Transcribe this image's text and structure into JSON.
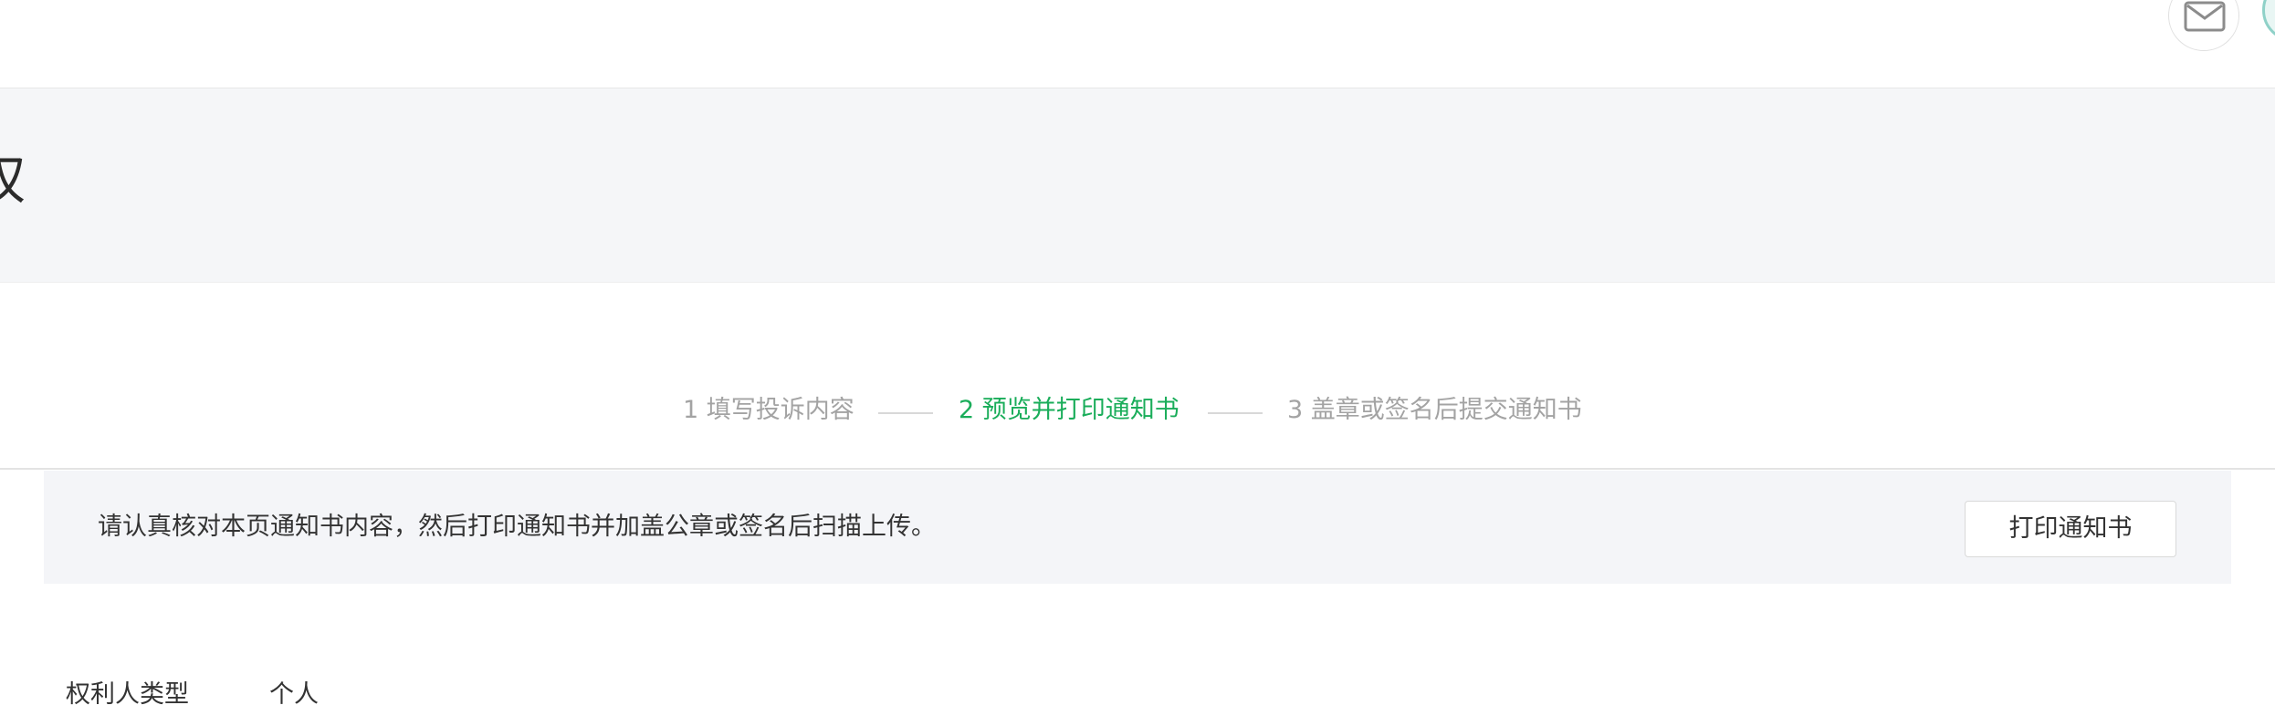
{
  "header": {
    "mail_icon": "mail-icon",
    "avatar_icon": "avatar-icon"
  },
  "page": {
    "title_fragment": "权"
  },
  "steps": [
    {
      "label": "1 填写投诉内容",
      "state": "done"
    },
    {
      "label": "2 预览并打印通知书",
      "state": "active"
    },
    {
      "label": "3 盖章或签名后提交通知书",
      "state": "pending"
    }
  ],
  "notice": {
    "text": "请认真核对本页通知书内容，然后打印通知书并加盖公章或签名后扫描上传。",
    "print_button_label": "打印通知书"
  },
  "details": {
    "rights_holder_type_label": "权利人类型",
    "rights_holder_type_value": "个人"
  },
  "colors": {
    "accent_green": "#1aad5a",
    "inactive_step": "#a3a3a3",
    "band_background": "#f5f6f8"
  }
}
